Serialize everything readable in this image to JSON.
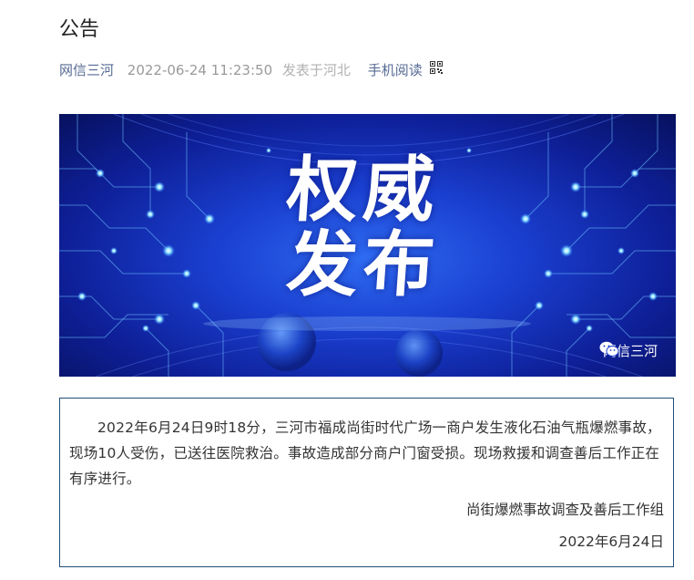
{
  "article": {
    "title": "公告",
    "account": "网信三河",
    "publish_time": "2022-06-24 11:23:50",
    "location": "发表于河北",
    "mobile_read_label": "手机阅读",
    "mobile_read_icon": "qr-code-icon"
  },
  "banner": {
    "line1": "权威",
    "line2": "发布",
    "watermark_icon": "wechat-icon",
    "watermark": "网信三河",
    "colors": {
      "center": "#2f6cf3",
      "edge": "#07115e",
      "glow": "#7fd8ff"
    }
  },
  "notice": {
    "body": "2022年6月24日9时18分，三河市福成尚街时代广场一商户发生液化石油气瓶爆燃事故，现场10人受伤，已送往医院救治。事故造成部分商户门窗受损。现场救援和调查善后工作正在有序进行。",
    "signature": "尚街爆燃事故调查及善后工作组",
    "date": "2022年6月24日",
    "border_color": "#1f4e79"
  }
}
